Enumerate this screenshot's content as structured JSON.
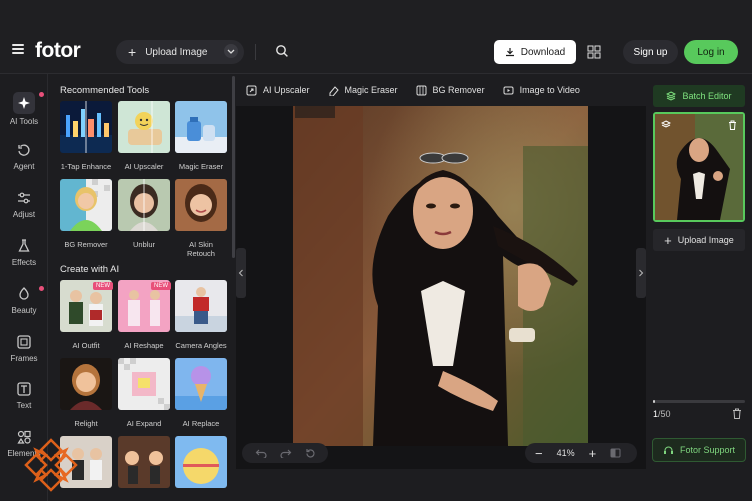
{
  "header": {
    "logo": "fotor",
    "upload_label": "Upload Image",
    "download_label": "Download",
    "signup_label": "Sign up",
    "login_label": "Log in"
  },
  "rail": {
    "items": [
      {
        "label": "AI Tools",
        "icon": "sparkle-icon"
      },
      {
        "label": "Agent",
        "icon": "agent-icon"
      },
      {
        "label": "Adjust",
        "icon": "sliders-icon"
      },
      {
        "label": "Effects",
        "icon": "flask-icon"
      },
      {
        "label": "Beauty",
        "icon": "beauty-icon"
      },
      {
        "label": "Frames",
        "icon": "frame-icon"
      },
      {
        "label": "Text",
        "icon": "text-icon"
      },
      {
        "label": "Elements",
        "icon": "elements-icon"
      }
    ]
  },
  "tools": {
    "recommended_title": "Recommended Tools",
    "recommended": [
      {
        "label": "1-Tap Enhance"
      },
      {
        "label": "AI Upscaler"
      },
      {
        "label": "Magic Eraser"
      },
      {
        "label": "BG Remover"
      },
      {
        "label": "Unblur"
      },
      {
        "label": "AI Skin Retouch"
      }
    ],
    "create_title": "Create with AI",
    "create": [
      {
        "label": "AI Outfit",
        "badge": "NEW"
      },
      {
        "label": "AI Reshape",
        "badge": "NEW"
      },
      {
        "label": "Camera Angles"
      },
      {
        "label": "Relight"
      },
      {
        "label": "AI Expand"
      },
      {
        "label": "AI Replace"
      }
    ]
  },
  "subtoolbar": {
    "items": [
      "AI Upscaler",
      "Magic Eraser",
      "BG Remover",
      "Image to Video"
    ]
  },
  "canvas": {
    "zoom": "41%"
  },
  "right_panel": {
    "batch_label": "Batch Editor",
    "upload_label": "Upload Image",
    "count_current": "1",
    "count_total": "/50",
    "support_label": "Fotor Support"
  },
  "colors": {
    "accent": "#58c95c",
    "background": "#1d1d20",
    "badge": "#e8507a"
  }
}
